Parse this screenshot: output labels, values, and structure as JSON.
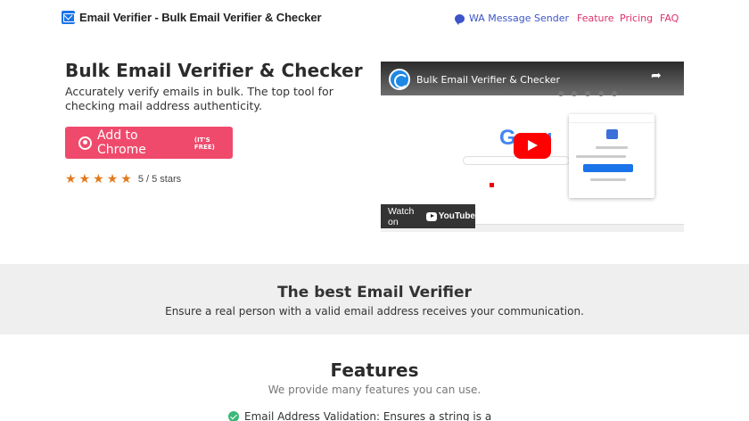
{
  "nav": {
    "brand": "Email Verifier - Bulk Email Verifier & Checker",
    "wa_link": "WA Message Sender",
    "links": [
      "Feature",
      "Pricing",
      "FAQ"
    ]
  },
  "hero": {
    "title": "Bulk Email Verifier & Checker",
    "subtitle": "Accurately verify emails in bulk. The top tool for checking mail address authenticity.",
    "cta_label": "Add to Chrome",
    "cta_badge": "(IT'S FREE)",
    "rating": {
      "stars": 5,
      "max": 5,
      "text": "5 / 5 stars"
    }
  },
  "video": {
    "title": "Bulk Email Verifier & Checker",
    "watch_label": "Watch on",
    "platform": "YouTube",
    "search_brand": "Google"
  },
  "band": {
    "title": "The best Email Verifier",
    "subtitle": "Ensure a real person with a valid email address receives your communication."
  },
  "features": {
    "title": "Features",
    "subtitle": "We provide many features you can use.",
    "items": [
      "Email Address Validation: Ensures a string is a"
    ]
  },
  "colors": {
    "accent": "#ef4a6c",
    "nav_link": "#e0306a",
    "wa_link": "#3b55c9",
    "star": "#e07a1f",
    "band_bg": "#efefef",
    "check": "#3cb878"
  }
}
